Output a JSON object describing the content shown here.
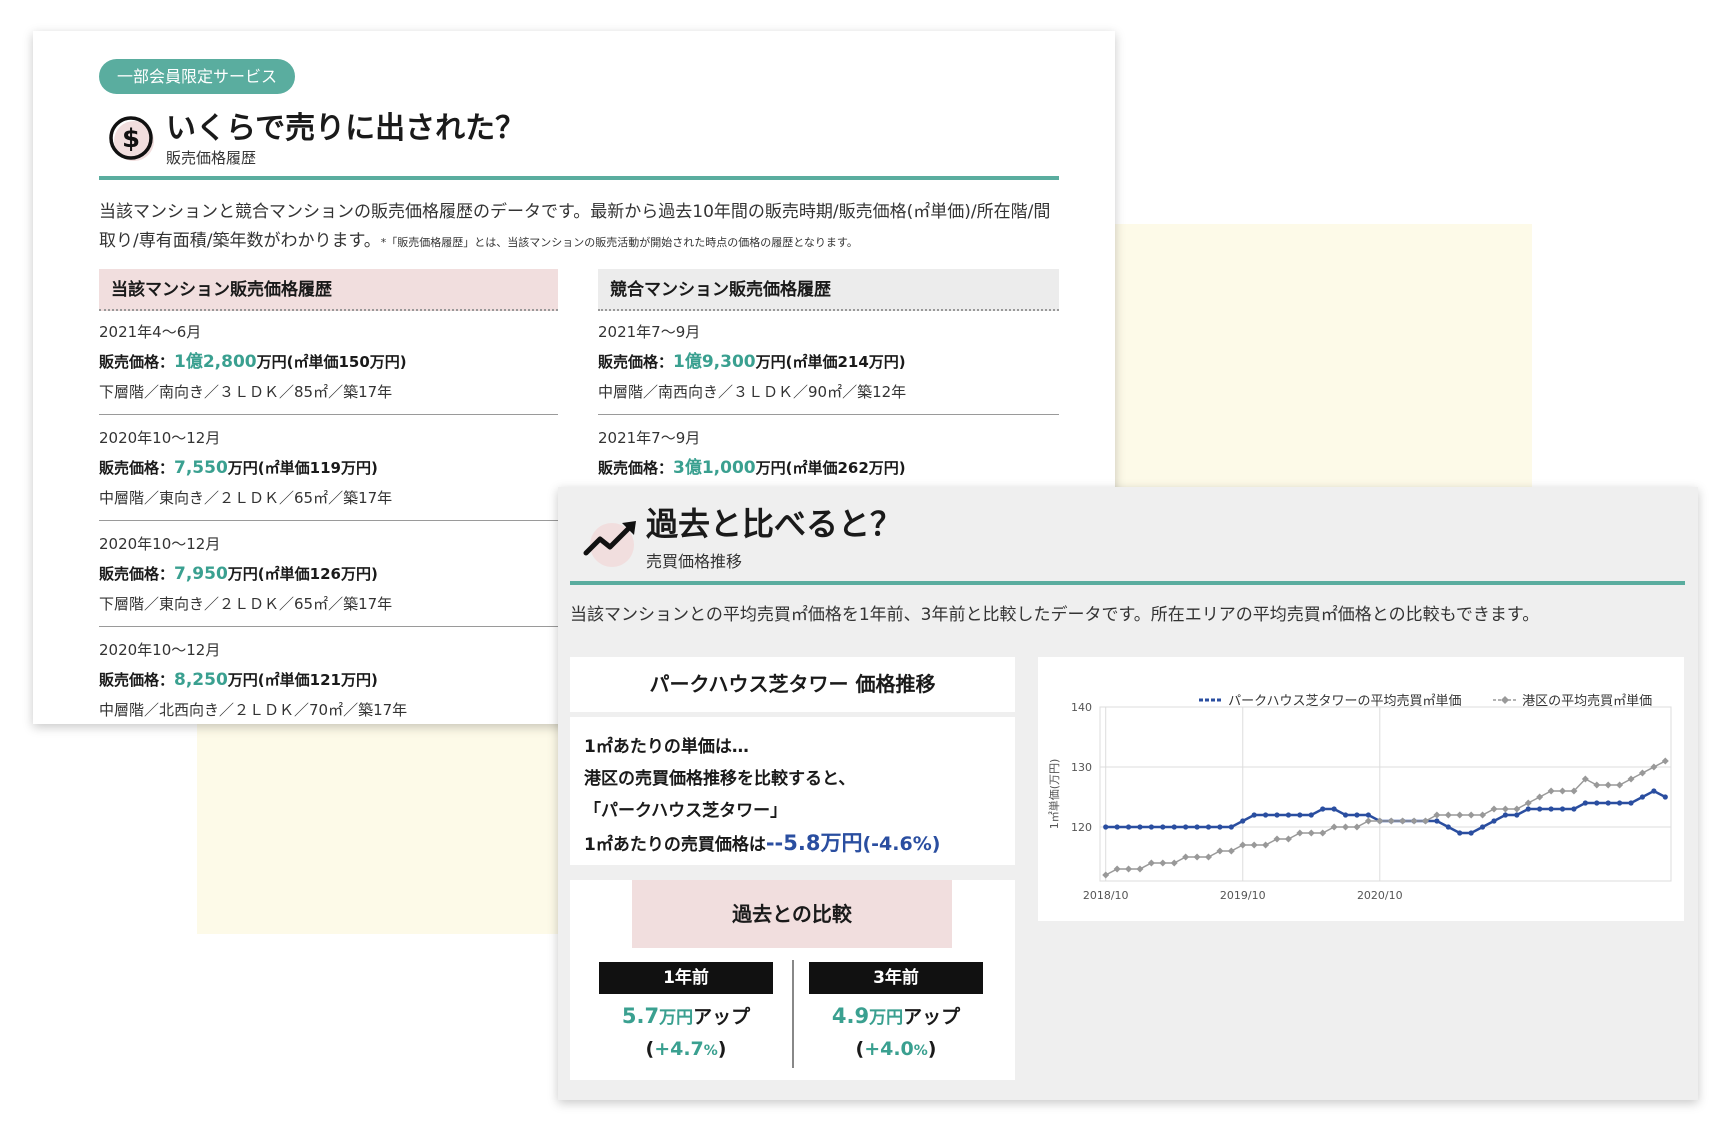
{
  "sale_history": {
    "badge": "一部会員限定サービス",
    "title": "いくらで売りに出された？",
    "subtitle": "販売価格履歴",
    "description_main": "当該マンションと競合マンションの販売価格履歴のデータです。最新から過去10年間の販売時期/販売価格(㎡単価)/所在階/間取り/専有面積/築年数がわかります。",
    "description_note": "*「販売価格履歴」とは、当該マンションの販売活動が開始された時点の価格の履歴となります。",
    "price_label": "販売価格：",
    "own": {
      "heading": "当該マンション販売価格履歴",
      "entries": [
        {
          "date": "2021年4〜6月",
          "price": "1億2,800",
          "unit": "万円(㎡単価150万円)",
          "info": "下層階／南向き／３ＬＤＫ／85㎡／築17年"
        },
        {
          "date": "2020年10〜12月",
          "price": "7,550",
          "unit": "万円(㎡単価119万円)",
          "info": "中層階／東向き／２ＬＤＫ／65㎡／築17年"
        },
        {
          "date": "2020年10〜12月",
          "price": "7,950",
          "unit": "万円(㎡単価126万円)",
          "info": "下層階／東向き／２ＬＤＫ／65㎡／築17年"
        },
        {
          "date": "2020年10〜12月",
          "price": "8,250",
          "unit": "万円(㎡単価121万円)",
          "info": "中層階／北西向き／２ＬＤＫ／70㎡／築17年"
        }
      ]
    },
    "competitor": {
      "heading": "競合マンション販売価格履歴",
      "entries": [
        {
          "date": "2021年7〜9月",
          "price": "1億9,300",
          "unit": "万円(㎡単価214万円)",
          "info": "中層階／南西向き／３ＬＤＫ／90㎡／築12年"
        },
        {
          "date": "2021年7〜9月",
          "price": "3億1,000",
          "unit": "万円(㎡単価262万円)"
        }
      ]
    }
  },
  "trend": {
    "title": "過去と比べると？",
    "subtitle": "売買価格推移",
    "description": "当該マンションとの平均売買㎡価格を1年前、3年前と比較したデータです。所在エリアの平均売買㎡価格との比較もできます。",
    "box_title": "パークハウス芝タワー 価格推移",
    "text_lines": [
      "1㎡あたりの単価は…",
      "港区の売買価格推移を比較すると、",
      "「パークハウス芝タワー」"
    ],
    "text_result_prefix": "1㎡あたりの売買価格は",
    "text_result_value": "--5.8万円",
    "text_result_pct": "(-4.6%)",
    "comparison_title": "過去との比較",
    "comparisons": [
      {
        "tag": "1年前",
        "value": "5.7",
        "unit": "万円",
        "suffix": "アップ",
        "pct_open": "(",
        "pct": "+4.7",
        "pct_unit": "%",
        "pct_close": ")"
      },
      {
        "tag": "3年前",
        "value": "4.9",
        "unit": "万円",
        "suffix": "アップ",
        "pct_open": "(",
        "pct": "+4.0",
        "pct_unit": "%",
        "pct_close": ")"
      }
    ],
    "colors": {
      "accent": "#5aad9f",
      "series_main": "#2a4ea0",
      "series_area": "#999999",
      "teal_value": "#3aa090"
    }
  },
  "chart_data": {
    "type": "line",
    "ylabel": "1㎡単価(万円)",
    "ylim": [
      111,
      140
    ],
    "yticks": [
      120,
      130,
      140
    ],
    "xticks": [
      "2018/10",
      "2019/10",
      "2020/10"
    ],
    "x_start": "2018/10",
    "x_step_months": 1,
    "grid": true,
    "legend_position": "top-right",
    "series": [
      {
        "name": "パークハウス芝タワーの平均売買㎡単価",
        "color": "#2a4ea0",
        "values": [
          120,
          120,
          120,
          120,
          120,
          120,
          120,
          120,
          120,
          120,
          120,
          120,
          121,
          122,
          122,
          122,
          122,
          122,
          122,
          123,
          123,
          122,
          122,
          122,
          121,
          121,
          121,
          121,
          121,
          121,
          120,
          119,
          119,
          120,
          121,
          122,
          122,
          123,
          123,
          123,
          123,
          123,
          124,
          124,
          124,
          124,
          124,
          125,
          126,
          125
        ]
      },
      {
        "name": "港区の平均売買㎡単価",
        "color": "#999999",
        "values": [
          112,
          113,
          113,
          113,
          114,
          114,
          114,
          115,
          115,
          115,
          116,
          116,
          117,
          117,
          117,
          118,
          118,
          119,
          119,
          119,
          120,
          120,
          120,
          121,
          121,
          121,
          121,
          121,
          121,
          122,
          122,
          122,
          122,
          122,
          123,
          123,
          123,
          124,
          125,
          126,
          126,
          126,
          128,
          127,
          127,
          127,
          128,
          129,
          130,
          131
        ]
      }
    ]
  }
}
